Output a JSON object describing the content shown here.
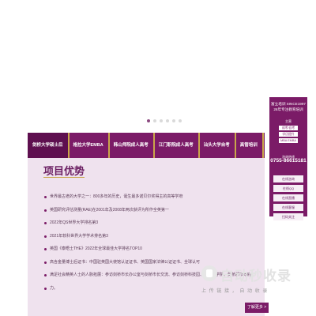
{
  "carousel": {
    "dot_count": 6,
    "active_index": 0
  },
  "nav": {
    "items": [
      {
        "label": "剑桥大学硕士后",
        "active": true
      },
      {
        "label": "格拉大学EMBA",
        "active": false
      },
      {
        "label": "韩山师院成人高考",
        "active": false
      },
      {
        "label": "江门职院成人高考",
        "active": false
      },
      {
        "label": "汕头大学自考",
        "active": false
      },
      {
        "label": "高管培训",
        "active": false
      },
      {
        "label": "企业内",
        "active": false
      }
    ]
  },
  "main": {
    "section_title": "项目优势",
    "advantages": [
      "世界最古老的大学之一：800多年的历史，诞生最多诺贝尔奖得主的高等学府",
      "英国研究评估测量(RAE)在2001年及2008年两次获评为所作全英第一",
      "2022年QS世界大学排名第3",
      "2021年软科世界大学学术排名第3",
      "英国《泰晤士THE》2022年全球最佳大学排名TOP10",
      "高含金量博士后证书：中国驻英国大使馆认证证书、英国国家法律公证证书、全球认可",
      "满足社会精英人士的人脉拓展：参访剑桥市长办公室与剑桥市长交流、参访剑桥科技园、剑桥商学院、剑桥郡市政府",
      "力。"
    ],
    "more_label": "了解更多 >"
  },
  "float_panel": {
    "title_line1": "富立培训 SINCE1997",
    "title_line2": "26年专注教育培训",
    "subtitle": "主营",
    "tags": [
      "成考/自考",
      "学历提升",
      "MBA EMBA"
    ],
    "cta": "咨询热线",
    "phone": "0755-86615181"
  },
  "sidebar": {
    "links": [
      "在线咨询",
      "在线QQ",
      "在线直播",
      "在线客服",
      "扫码关注"
    ]
  },
  "watermark": {
    "title": "自动秒收录",
    "subtitle": "上 传 链 接 ， 自 动 收 录"
  },
  "colors": {
    "primary": "#7b1b67",
    "accent": "#c9a64a",
    "panel_bg": "#efe2ee"
  }
}
